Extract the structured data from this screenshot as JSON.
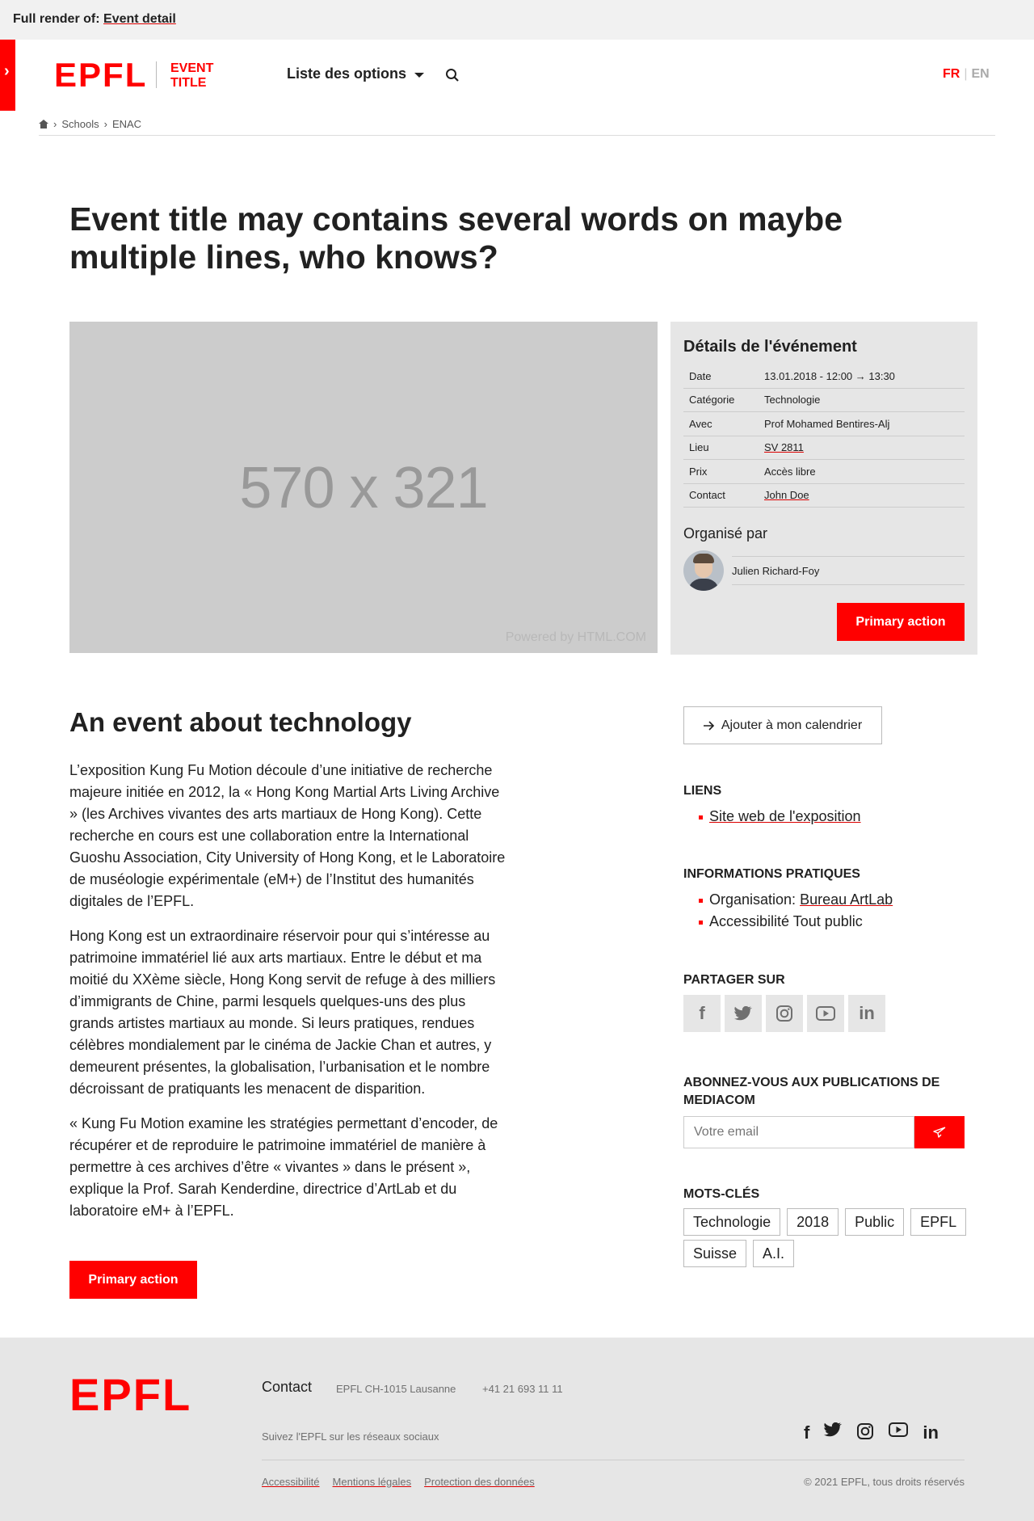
{
  "render_label": "Full render of:",
  "render_link": "Event detail",
  "drawer_toggle": "›",
  "header": {
    "logo_text": [
      "E",
      "P",
      "F",
      "L"
    ],
    "site_title_line1": "EVENT",
    "site_title_line2": "TITLE",
    "nav_label": "Liste des options",
    "lang_fr": "FR",
    "lang_sep": "|",
    "lang_en": "EN"
  },
  "breadcrumb": {
    "sep": "›",
    "items": [
      "Schools",
      "ENAC"
    ]
  },
  "title": "Event title may contains several words on maybe multiple lines, who knows?",
  "hero": {
    "placeholder": "570 x 321",
    "powered": "Powered by HTML.COM"
  },
  "details": {
    "heading": "Détails de l'événement",
    "rows": [
      {
        "k": "Date",
        "v": "13.01.2018 - 12:00 → 13:30"
      },
      {
        "k": "Catégorie",
        "v": "Technologie"
      },
      {
        "k": "Avec",
        "v": "Prof Mohamed Bentires-Alj"
      },
      {
        "k": "Lieu",
        "v": "SV 2811"
      },
      {
        "k": "Prix",
        "v": "Accès libre"
      },
      {
        "k": "Contact",
        "v": "John Doe"
      }
    ],
    "org_title": "Organisé par",
    "organizer": "Julien Richard-Foy",
    "action": "Primary action"
  },
  "article": {
    "heading": "An event about technology",
    "paragraphs": [
      "L’exposition Kung Fu Motion découle d’une initiative de recherche majeure initiée en 2012, la « Hong Kong Martial Arts Living Archive » (les Archives vivantes des arts martiaux de Hong Kong). Cette recherche en cours est une collaboration entre la International Guoshu Association, City University of Hong Kong, et le Laboratoire de muséologie expérimentale (eM+) de l’Institut des humanités digitales de l’EPFL.",
      "Hong Kong est un extraordinaire réservoir pour qui s’intéresse au patrimoine immatériel lié aux arts martiaux. Entre le début et ma moitié du XXème siècle, Hong Kong servit de refuge à des milliers d’immigrants de Chine, parmi lesquels quelques-uns des plus grands artistes martiaux au monde. Si leurs pratiques, rendues célèbres mondialement par le cinéma de Jackie Chan et autres, y demeurent présentes, la globalisation, l’urbanisation et le nombre décroissant de pratiquants les menacent de disparition.",
      "« Kung Fu Motion examine les stratégies permettant d’encoder, de récupérer et de reproduire le patrimoine immatériel de manière à permettre à ces archives d’être « vivantes » dans le présent », explique la Prof. Sarah Kenderdine, directrice d’ArtLab et du laboratoire eM+ à l’EPFL."
    ],
    "action": "Primary action"
  },
  "sidebar": {
    "calendar": "Ajouter à mon calendrier",
    "links_title": "LIENS",
    "link1": "Site web de l'exposition",
    "info_title": "INFORMATIONS PRATIQUES",
    "org_label": "Organisation:",
    "org_value": "Bureau ArtLab",
    "access_label": "Accessibilité",
    "access_value": "Tout public",
    "share_title": "PARTAGER SUR",
    "subscribe_title": "ABONNEZ-VOUS AUX PUBLICATIONS DE MEDIACOM",
    "email_placeholder": "Votre email",
    "keywords_title": "MOTS-CLÉS",
    "tags": [
      "Technologie",
      "2018",
      "Public",
      "EPFL",
      "Suisse",
      "A.I."
    ]
  },
  "footer": {
    "contact": "Contact",
    "address": "EPFL CH-1015 Lausanne",
    "phone": "+41 21 693 11 11",
    "follow": "Suivez l'EPFL sur les réseaux sociaux",
    "links": [
      "Accessibilité",
      "Mentions légales",
      "Protection des données"
    ],
    "copyright": "© 2021 EPFL, tous droits réservés"
  },
  "colors": {
    "accent": "#ff0000",
    "panel": "#e6e6e6"
  }
}
